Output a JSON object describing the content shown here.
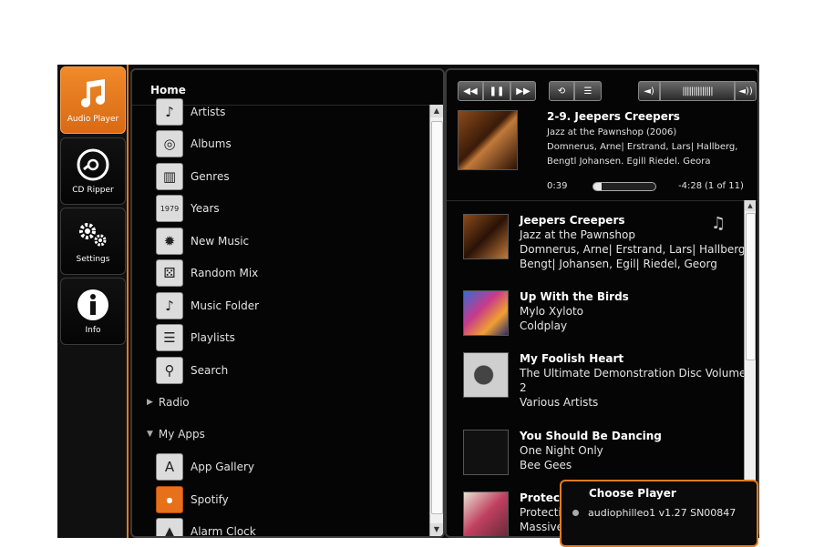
{
  "nav": {
    "items": [
      {
        "label": "Audio Player",
        "icon": "music-note-icon",
        "active": true
      },
      {
        "label": "CD Ripper",
        "icon": "cd-icon",
        "active": false
      },
      {
        "label": "Settings",
        "icon": "gears-icon",
        "active": false
      },
      {
        "label": "Info",
        "icon": "info-icon",
        "active": false
      }
    ]
  },
  "library": {
    "title": "Home",
    "items": [
      {
        "label": "Artists",
        "icon": "artists-icon"
      },
      {
        "label": "Albums",
        "icon": "albums-icon"
      },
      {
        "label": "Genres",
        "icon": "genres-icon"
      },
      {
        "label": "Years",
        "icon": "years-icon",
        "glyph": "1979"
      },
      {
        "label": "New Music",
        "icon": "new-music-icon"
      },
      {
        "label": "Random Mix",
        "icon": "dice-icon"
      },
      {
        "label": "Music Folder",
        "icon": "folder-icon"
      },
      {
        "label": "Playlists",
        "icon": "playlist-icon"
      },
      {
        "label": "Search",
        "icon": "search-icon"
      }
    ],
    "radio_label": "Radio",
    "myapps_label": "My Apps",
    "apps": [
      {
        "label": "App Gallery",
        "icon": "app-gallery-icon"
      },
      {
        "label": "Spotify",
        "icon": "spotify-icon"
      },
      {
        "label": "Alarm Clock",
        "icon": "alarm-clock-icon"
      }
    ]
  },
  "now_playing": {
    "title": "2-9. Jeepers Creepers",
    "album": "Jazz at the Pawnshop (2006)",
    "artists_line1": "Domnerus, Arne| Erstrand, Lars| Hallberg,",
    "artists_line2": "Bengtl Johansen. Egill Riedel. Geora",
    "elapsed": "0:39",
    "remaining": "-4:28",
    "track_pos": "(1 of 11)",
    "progress": 0.13
  },
  "queue": [
    {
      "title": "Jeepers Creepers",
      "lines": [
        "Jazz at the Pawnshop",
        "Domnerus, Arne| Erstrand, Lars| Hallberg,",
        "Bengt| Johansen, Egil| Riedel, Georg"
      ],
      "art_color": "#7a3a10"
    },
    {
      "title": "Up With the Birds",
      "lines": [
        "Mylo Xyloto",
        "Coldplay"
      ],
      "art_color": "#6a3aa0"
    },
    {
      "title": "My Foolish Heart",
      "lines": [
        "The Ultimate Demonstration Disc Volume",
        "2",
        "Various Artists"
      ],
      "art_color": "#d0d0d0"
    },
    {
      "title": "You Should Be Dancing",
      "lines": [
        "One Night Only",
        "Bee Gees"
      ],
      "art_color": "#1a1a1a"
    },
    {
      "title": "Protect",
      "lines": [
        "Protecti",
        "Massive"
      ],
      "art_color": "#b04060"
    }
  ],
  "popup": {
    "title": "Choose Player",
    "option": "audiophilleo1 v1.27 SN00847"
  }
}
